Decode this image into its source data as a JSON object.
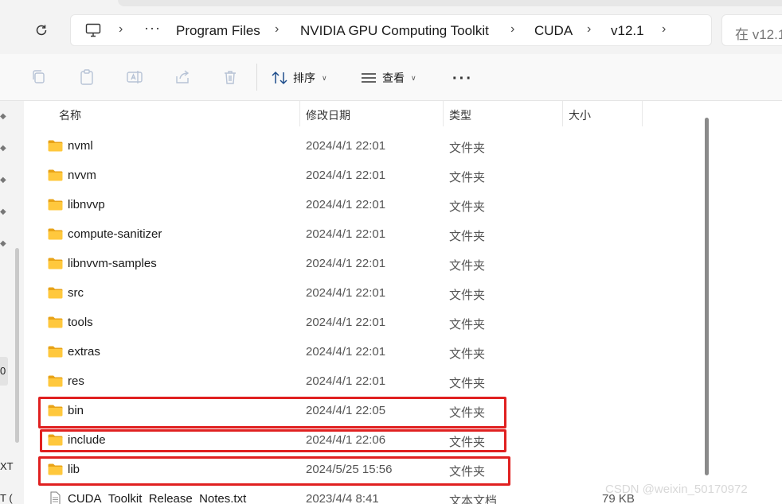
{
  "address": {
    "crumbs": [
      "Program Files",
      "NVIDIA GPU Computing Toolkit",
      "CUDA",
      "v12.1"
    ],
    "overflow": "···",
    "search_placeholder": "在 v12.1"
  },
  "toolbar": {
    "sort_label": "排序",
    "view_label": "查看",
    "more_label": "···"
  },
  "columns": {
    "name": "名称",
    "date": "修改日期",
    "type": "类型",
    "size": "大小"
  },
  "files": [
    {
      "name": "nvml",
      "date": "2024/4/1 22:01",
      "type": "文件夹",
      "size": "",
      "icon": "folder-icon"
    },
    {
      "name": "nvvm",
      "date": "2024/4/1 22:01",
      "type": "文件夹",
      "size": "",
      "icon": "folder-icon"
    },
    {
      "name": "libnvvp",
      "date": "2024/4/1 22:01",
      "type": "文件夹",
      "size": "",
      "icon": "folder-icon"
    },
    {
      "name": "compute-sanitizer",
      "date": "2024/4/1 22:01",
      "type": "文件夹",
      "size": "",
      "icon": "folder-icon"
    },
    {
      "name": "libnvvm-samples",
      "date": "2024/4/1 22:01",
      "type": "文件夹",
      "size": "",
      "icon": "folder-icon"
    },
    {
      "name": "src",
      "date": "2024/4/1 22:01",
      "type": "文件夹",
      "size": "",
      "icon": "folder-icon"
    },
    {
      "name": "tools",
      "date": "2024/4/1 22:01",
      "type": "文件夹",
      "size": "",
      "icon": "folder-icon"
    },
    {
      "name": "extras",
      "date": "2024/4/1 22:01",
      "type": "文件夹",
      "size": "",
      "icon": "folder-icon"
    },
    {
      "name": "res",
      "date": "2024/4/1 22:01",
      "type": "文件夹",
      "size": "",
      "icon": "folder-icon"
    },
    {
      "name": "bin",
      "date": "2024/4/1 22:05",
      "type": "文件夹",
      "size": "",
      "icon": "folder-icon"
    },
    {
      "name": "include",
      "date": "2024/4/1 22:06",
      "type": "文件夹",
      "size": "",
      "icon": "folder-icon"
    },
    {
      "name": "lib",
      "date": "2024/5/25 15:56",
      "type": "文件夹",
      "size": "",
      "icon": "folder-icon"
    },
    {
      "name": "CUDA_Toolkit_Release_Notes.txt",
      "date": "2023/4/4 8:41",
      "type": "文本文档",
      "size": "79 KB",
      "icon": "text-file-icon"
    }
  ],
  "left_fragments": [
    "0",
    "XT",
    "T ("
  ],
  "watermark": "CSDN @weixin_50170972",
  "colors": {
    "highlight": "#e02020",
    "folder_front": "#ffc83d",
    "folder_back": "#e8a317"
  }
}
